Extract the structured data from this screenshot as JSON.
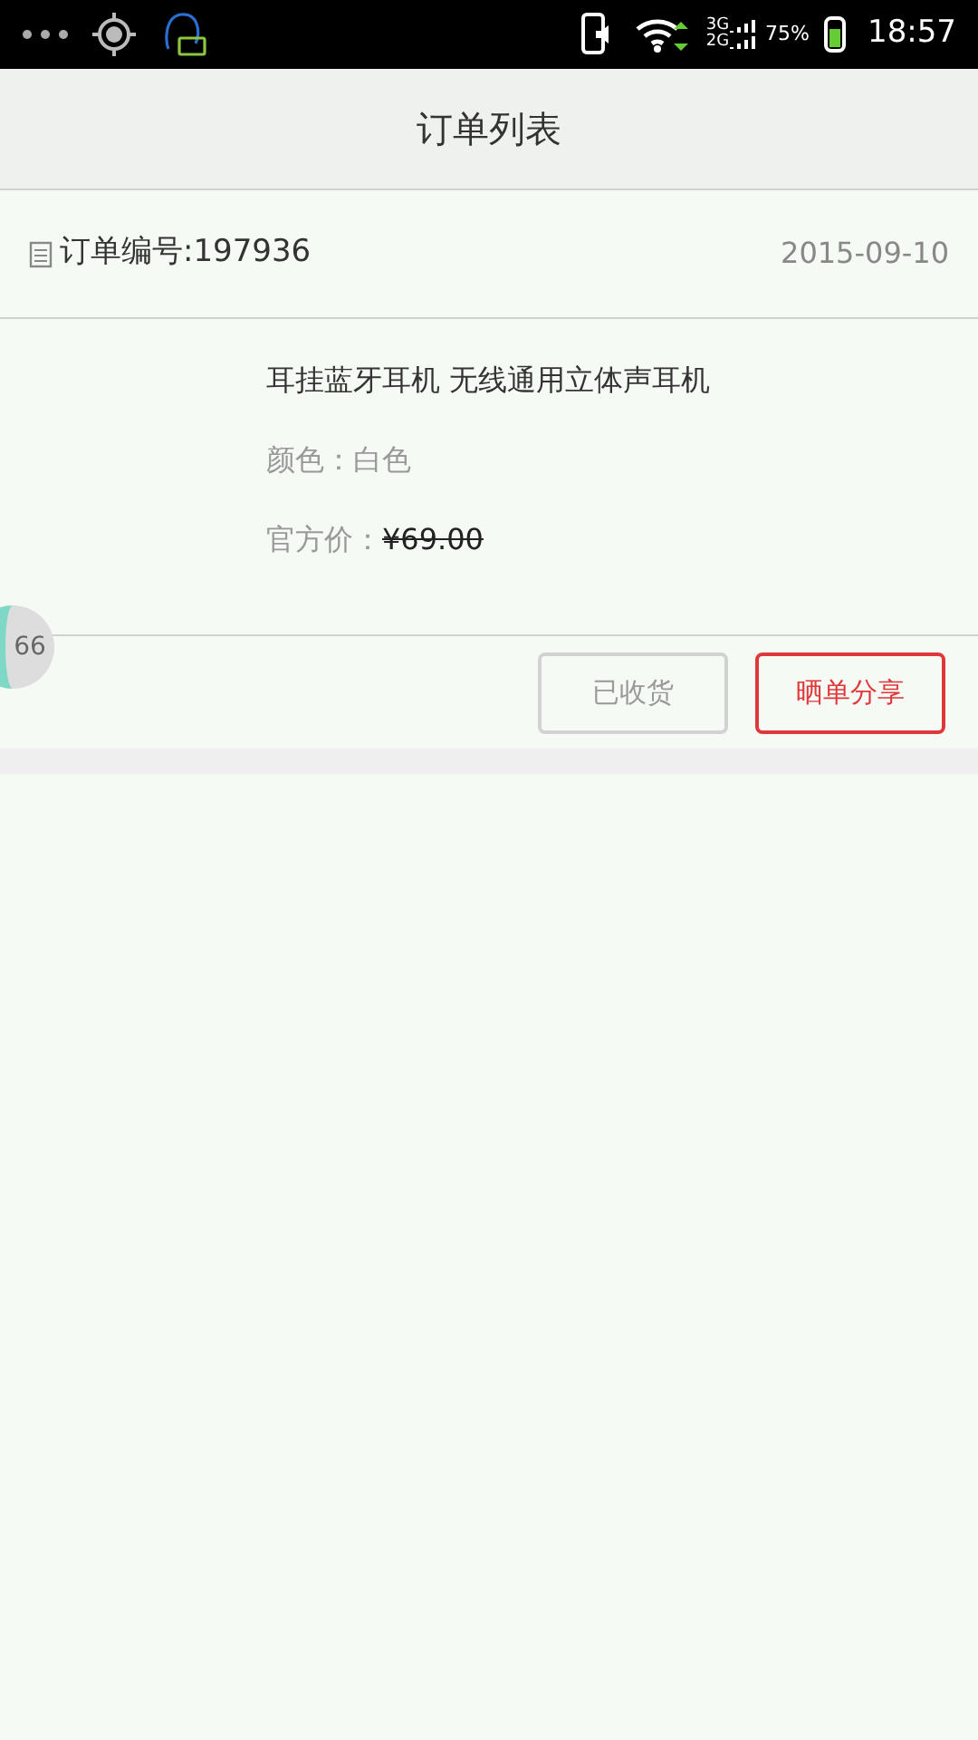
{
  "status_bar": {
    "network_top": "3G",
    "network_bottom": "2G",
    "battery": "75%",
    "time": "18:57"
  },
  "header": {
    "title": "订单列表"
  },
  "order": {
    "number_label": "订单编号:197936",
    "date": "2015-09-10",
    "product_name": "耳挂蓝牙耳机 无线通用立体声耳机",
    "color_label": "颜色：白色",
    "price_label": "官方价：",
    "price": "¥69.00",
    "buttons": [
      {
        "label": "已收货",
        "kind": "plain"
      },
      {
        "label": "晒单分享",
        "kind": "primary"
      }
    ]
  },
  "floating_badge": "66"
}
